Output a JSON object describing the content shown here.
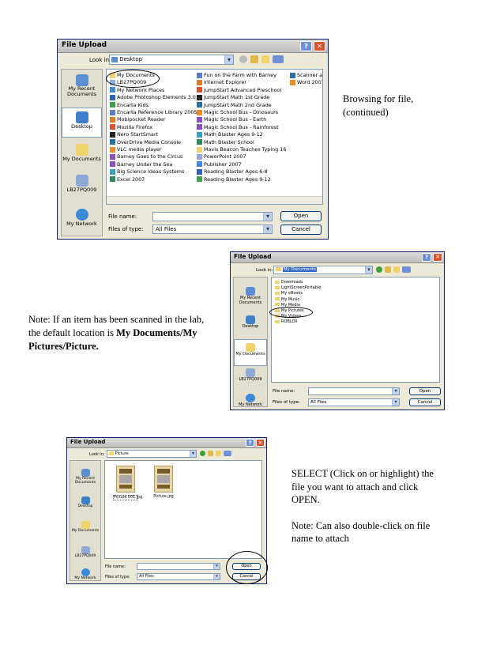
{
  "captions": {
    "browsing_line1": "Browsing for file,",
    "browsing_line2": "(continued)",
    "note_line1": "Note:  If an item has been scanned in the lab,",
    "note_line2_plain": "the default location is ",
    "note_line2_bold": "My Documents/My",
    "note_line3_bold": "Pictures/Picture.",
    "select_line1": "SELECT (Click on or highlight) the",
    "select_line2": "file you want to attach and click",
    "select_line3": "OPEN.",
    "note2_line1": "Note:  Can also double-click on file",
    "note2_line2": "name to attach"
  },
  "dialog_common": {
    "title": "File Upload",
    "help_glyph": "?",
    "close_glyph": "✕",
    "look_in_label": "Look in:",
    "file_name_label": "File name:",
    "files_of_type_label": "Files of type:",
    "files_of_type_value": "All Files",
    "open_button": "Open",
    "cancel_button": "Cancel",
    "dropdown_arrow": "▾",
    "places": [
      "My Recent Documents",
      "Desktop",
      "My Documents",
      "LB27PQ009",
      "My Network"
    ]
  },
  "dialog1": {
    "look_in_value": "Desktop",
    "items_col1": [
      "My Documents",
      "LB27PQ009",
      "My Network Places",
      "Adobe Photoshop Elements 3.0",
      "Encarta Kids",
      "Encarta Reference Library 2005",
      "Mobipocket Reader",
      "Mozilla Firefox",
      "Nero StartSmart",
      "OverDrive Media Console",
      "VLC media player",
      "Barney Goes to the Circus",
      "Barney Under the Sea",
      "Big Science Ideas Systems",
      "Excel 2007"
    ],
    "items_col2": [
      "Fun on the Farm with Barney",
      "Internet Explorer",
      "JumpStart Advanced Preschool",
      "JumpStart Math 1st Grade",
      "JumpStart Math 2nd Grade",
      "Magic School Bus - Dinosaurs",
      "Magic School Bus - Earth",
      "Magic School Bus - Rainforest",
      "Math Blaster Ages 9-12",
      "Math Blaster School",
      "Mavis Beacon Teaches Typing 16",
      "PowerPoint 2007",
      "Publisher 2007",
      "Reading Blaster Ages 6-8",
      "Reading Blaster Ages 9-12"
    ],
    "items_col3": [
      "Scanner and",
      "Word 2007"
    ],
    "file_name_value": ""
  },
  "dialog2": {
    "look_in_value": "My Documents",
    "items": [
      "Downloads",
      "LightScreenPortable",
      "My eBooks",
      "My Music",
      "My Media",
      "My Pictures",
      "My Videos",
      "ROBLOX"
    ],
    "file_name_value": ""
  },
  "dialog3": {
    "look_in_value": "Picture",
    "thumbnails": [
      "Picture 001.jpg",
      "Picture.jpg"
    ],
    "file_name_value": ""
  },
  "colors": {
    "dialog_bg": "#ece9d8",
    "title_bg": "#c8c8c8",
    "folder_yellow": "#f2d36b",
    "selection_blue": "#316ac5"
  }
}
